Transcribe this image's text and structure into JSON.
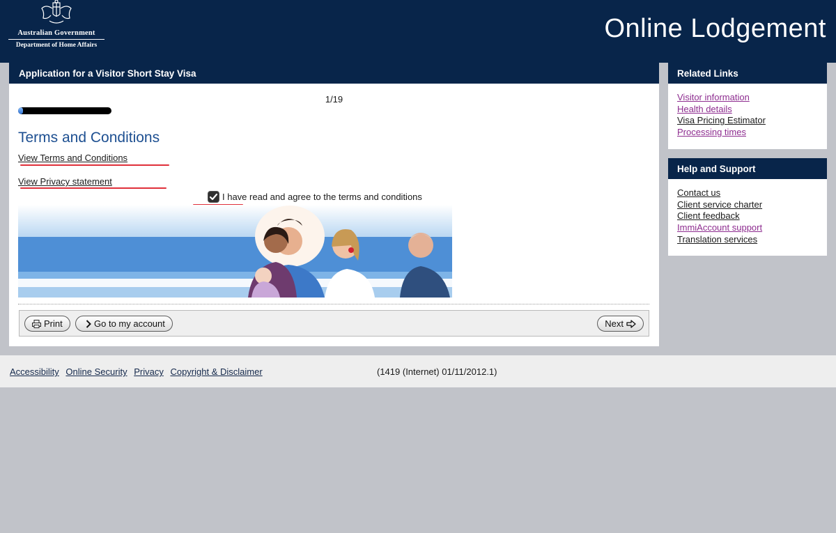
{
  "header": {
    "gov_name": "Australian Government",
    "dept_name": "Department of Home Affairs",
    "site_title": "Online Lodgement",
    "background_color": "#08254a"
  },
  "main": {
    "title": "Application for a Visitor Short Stay Visa",
    "step_counter": "1/19",
    "progress_fraction": 0.05,
    "section_title": "Terms and Conditions",
    "terms_link": "View Terms and Conditions",
    "privacy_link": "View Privacy statement",
    "agree_label": "I have read and agree to the terms and conditions",
    "agree_checked": true,
    "buttons": {
      "print": "Print",
      "account": "Go to my account",
      "next": "Next"
    }
  },
  "related_links": {
    "title": "Related Links",
    "items": [
      {
        "label": "Visitor information",
        "visited": true
      },
      {
        "label": "Health details",
        "visited": true
      },
      {
        "label": "Visa Pricing Estimator",
        "visited": false
      },
      {
        "label": "Processing times",
        "visited": true
      }
    ]
  },
  "help_support": {
    "title": "Help and Support",
    "items": [
      {
        "label": "Contact us",
        "visited": false
      },
      {
        "label": "Client service charter",
        "visited": false
      },
      {
        "label": "Client feedback",
        "visited": false
      },
      {
        "label": "ImmiAccount support",
        "visited": true
      },
      {
        "label": "Translation services",
        "visited": false
      }
    ]
  },
  "footer": {
    "links": [
      "Accessibility",
      "Online Security",
      "Privacy",
      "Copyright & Disclaimer"
    ],
    "version": "(1419 (Internet) 01/11/2012.1)"
  },
  "icons": {
    "crest": "coat-of-arms-icon",
    "print": "printer-icon",
    "account": "chevron-right-icon",
    "next": "arrow-right-icon",
    "check": "checkmark-icon"
  }
}
